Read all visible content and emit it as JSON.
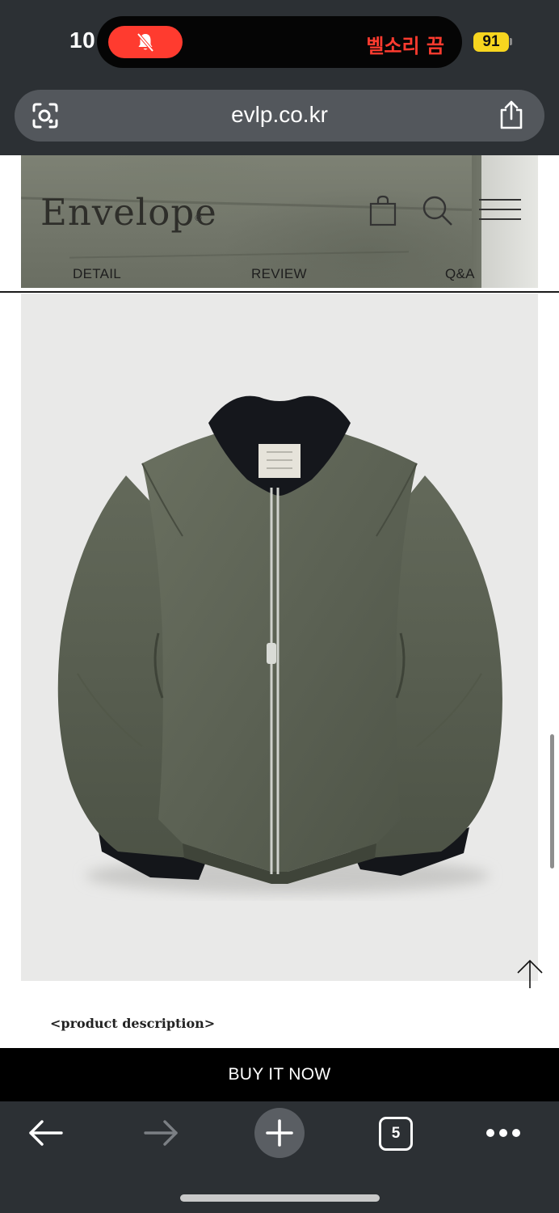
{
  "status_bar": {
    "time": "10",
    "ringer_status": "벨소리 끔",
    "battery_level": "91"
  },
  "browser": {
    "url": "evlp.co.kr",
    "open_tab_count": "5"
  },
  "site_header": {
    "brand": "Envelope",
    "brand_mark": "©"
  },
  "product_tabs": [
    "DETAIL",
    "REVIEW",
    "Q&A"
  ],
  "product": {
    "description_label": "<product description>",
    "buy_label": "BUY IT NOW"
  },
  "colors": {
    "chrome_background": "#2c3034",
    "url_bar": "#53575c",
    "mute_pill": "#ff3b2f",
    "battery": "#f7d51f",
    "buy_bar": "#000000",
    "jacket_olive": "#5c6254"
  },
  "icons": [
    "camera-lens-icon",
    "share-icon",
    "bell-slash-icon",
    "shopping-bag-icon",
    "search-icon",
    "hamburger-menu-icon",
    "arrow-up-icon",
    "back-arrow-icon",
    "forward-arrow-icon",
    "plus-icon",
    "more-dots-icon"
  ]
}
